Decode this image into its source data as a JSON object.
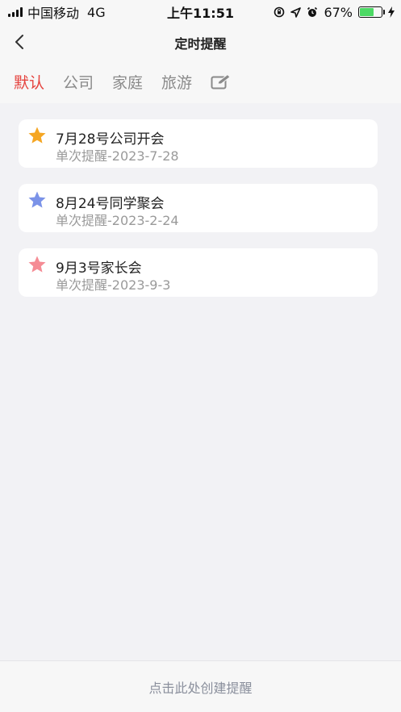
{
  "status_bar": {
    "carrier": "中国移动",
    "network": "4G",
    "time": "上午11:51",
    "battery": "67%",
    "battery_level": 0.67
  },
  "nav": {
    "title": "定时提醒"
  },
  "tabs": [
    {
      "label": "默认",
      "active": true
    },
    {
      "label": "公司",
      "active": false
    },
    {
      "label": "家庭",
      "active": false
    },
    {
      "label": "旅游",
      "active": false
    }
  ],
  "reminders": [
    {
      "title": "7月28号公司开会",
      "subtitle": "单次提醒-2023-7-28",
      "star_color": "#f5a623"
    },
    {
      "title": "8月24号同学聚会",
      "subtitle": "单次提醒-2023-2-24",
      "star_color": "#7b93e8"
    },
    {
      "title": "9月3号家长会",
      "subtitle": "单次提醒-2023-9-3",
      "star_color": "#f58c95"
    }
  ],
  "footer": {
    "create_label": "点击此处创建提醒"
  },
  "colors": {
    "accent": "#e5413c",
    "background": "#f2f2f5"
  }
}
